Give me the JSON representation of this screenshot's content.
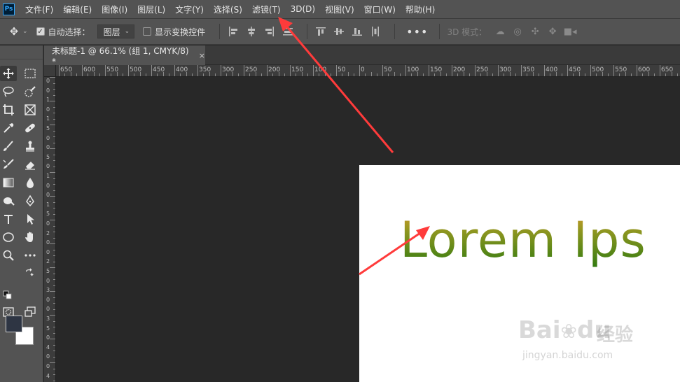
{
  "app": {
    "logo": "Ps",
    "menu": [
      "文件(F)",
      "编辑(E)",
      "图像(I)",
      "图层(L)",
      "文字(Y)",
      "选择(S)",
      "滤镜(T)",
      "3D(D)",
      "视图(V)",
      "窗口(W)",
      "帮助(H)"
    ]
  },
  "options": {
    "auto_select_label": "自动选择：",
    "auto_select_checked": true,
    "layer_dropdown": "图层",
    "show_transform_label": "显示变换控件",
    "show_transform_checked": false,
    "mode3d_label": "3D 模式：",
    "more": "•••"
  },
  "document": {
    "tab_title": "未标题-1 @ 66.1% (组 1, CMYK/8) *",
    "close": "×",
    "canvas_text": "Lorem Ips"
  },
  "ruler_h": [
    "650",
    "600",
    "550",
    "500",
    "450",
    "400",
    "350",
    "300",
    "250",
    "200",
    "150",
    "100",
    "50",
    "0",
    "50",
    "100",
    "150",
    "200",
    "250",
    "300",
    "350",
    "400",
    "450",
    "500",
    "550",
    "600",
    "650"
  ],
  "ruler_v": [
    "0",
    "0",
    "1",
    "0",
    "1",
    "5",
    "0",
    "0",
    "5",
    "0",
    "1",
    "0",
    "0",
    "1",
    "5",
    "0",
    "2",
    "0",
    "0",
    "2",
    "5",
    "0",
    "3",
    "0",
    "0",
    "3",
    "5",
    "0",
    "4",
    "0",
    "0",
    "4"
  ],
  "watermark": {
    "brand": "Bai",
    "brand2": "du",
    "cn": "经验",
    "url": "jingyan.baidu.com"
  },
  "colors": {
    "foreground": "#2e3543",
    "background": "#ffffff",
    "arrow": "#ff3b3b"
  },
  "tools": [
    "move-icon",
    "marquee-icon",
    "lasso-icon",
    "quick-select-icon",
    "crop-icon",
    "frame-icon",
    "eyedropper-icon",
    "healing-icon",
    "brush-icon",
    "stamp-icon",
    "history-brush-icon",
    "eraser-icon",
    "gradient-icon",
    "blur-icon",
    "dodge-icon",
    "pen-icon",
    "type-icon",
    "path-select-icon",
    "ellipse-icon",
    "hand-icon",
    "zoom-icon",
    "more-tools-icon"
  ]
}
